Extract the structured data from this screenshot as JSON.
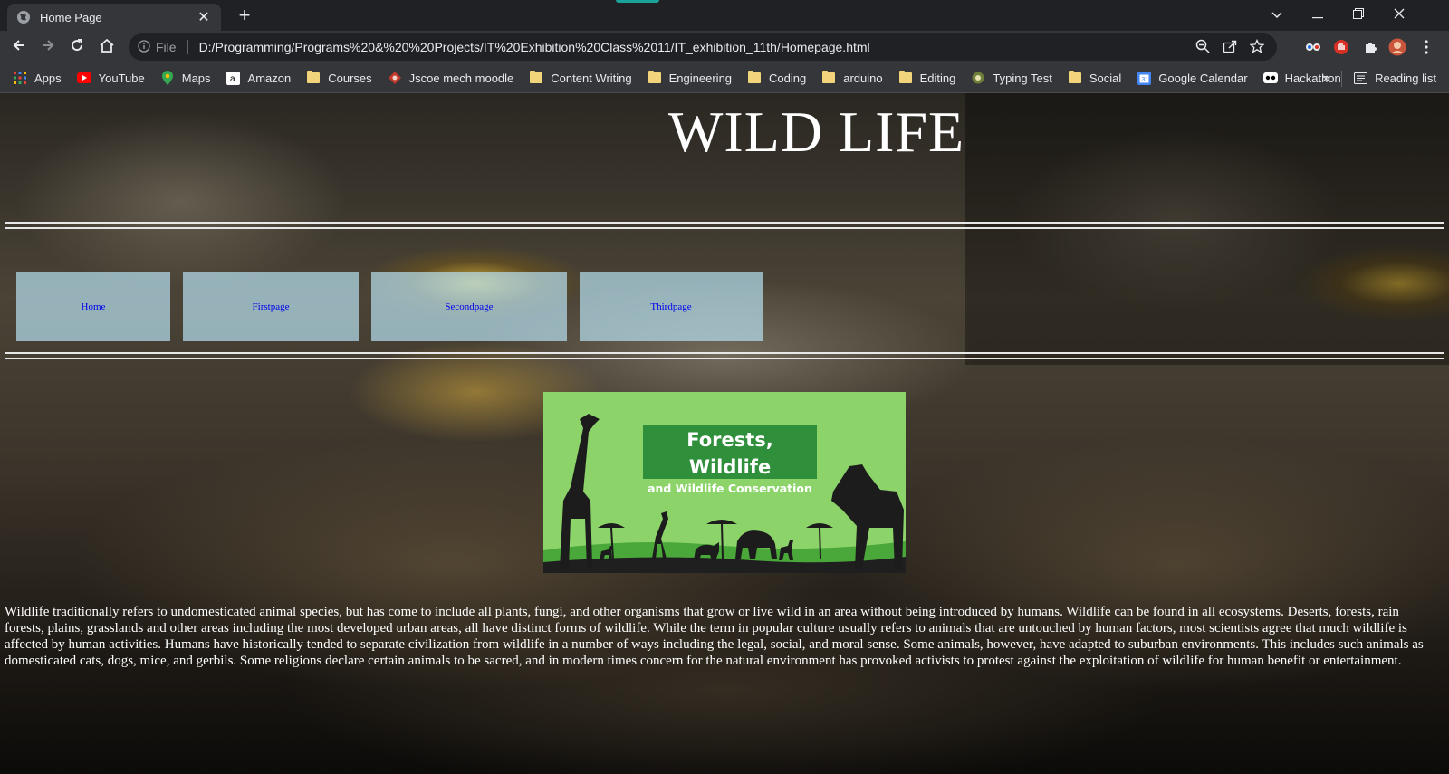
{
  "browser": {
    "tab": {
      "title": "Home Page",
      "close_glyph": "✕",
      "favicon": "globe-icon"
    },
    "new_tab_glyph": "+",
    "window_controls": [
      "chevron-down-icon",
      "minimize-icon",
      "restore-icon",
      "close-icon"
    ],
    "address": {
      "info_label": "File",
      "url": "D:/Programming/Programs%20&%20%20Projects/IT%20Exhibition%20Class%2011/IT_exhibition_11th/Homepage.html"
    },
    "bookmarks": [
      {
        "label": "Apps",
        "icon": "apps-grid-icon"
      },
      {
        "label": "YouTube",
        "icon": "youtube-icon"
      },
      {
        "label": "Maps",
        "icon": "maps-pin-icon"
      },
      {
        "label": "Amazon",
        "icon": "amazon-icon"
      },
      {
        "label": "Courses",
        "icon": "folder-icon"
      },
      {
        "label": "Jscoe mech moodle",
        "icon": "moodle-icon"
      },
      {
        "label": "Content Writing",
        "icon": "folder-icon"
      },
      {
        "label": "Engineering",
        "icon": "folder-icon"
      },
      {
        "label": "Coding",
        "icon": "folder-icon"
      },
      {
        "label": "arduino",
        "icon": "folder-icon"
      },
      {
        "label": "Editing",
        "icon": "folder-icon"
      },
      {
        "label": "Typing Test",
        "icon": "typing-test-icon"
      },
      {
        "label": "Social",
        "icon": "folder-icon"
      },
      {
        "label": "Google Calendar",
        "icon": "calendar-icon"
      },
      {
        "label": "Hackathon",
        "icon": "hackathon-icon"
      }
    ],
    "overflow_glyph": "»",
    "reading_list": "Reading list"
  },
  "page": {
    "title": "WILD LIFE",
    "nav": [
      {
        "label": "Home"
      },
      {
        "label": "Firstpage"
      },
      {
        "label": "Secondpage"
      },
      {
        "label": "Thirdpage"
      }
    ],
    "banner": {
      "line1": "Forests, Wildlife",
      "line2": "and Wildlife Conservation"
    },
    "paragraph": "Wildlife traditionally refers to undomesticated animal species, but has come to include all plants, fungi, and other organisms that grow or live wild in an area without being introduced by humans. Wildlife can be found in all ecosystems. Deserts, forests, rain forests, plains, grasslands and other areas including the most developed urban areas, all have distinct forms of wildlife. While the term in popular culture usually refers to animals that are untouched by human factors, most scientists agree that much wildlife is affected by human activities. Humans have historically tended to separate civilization from wildlife in a number of ways including the legal, social, and moral sense. Some animals, however, have adapted to suburban environments. This includes such animals as domesticated cats, dogs, mice, and gerbils. Some religions declare certain animals to be sacred, and in modern times concern for the natural environment has provoked activists to protest against the exploitation of wildlife for human benefit or entertainment."
  },
  "colors": {
    "chrome_dark": "#202124",
    "chrome_toolbar": "#35363a",
    "nav_box": "#b4dceb",
    "link": "#0000ee",
    "banner_green": "#8cd46a",
    "banner_title_bg": "#2f8f3a"
  }
}
